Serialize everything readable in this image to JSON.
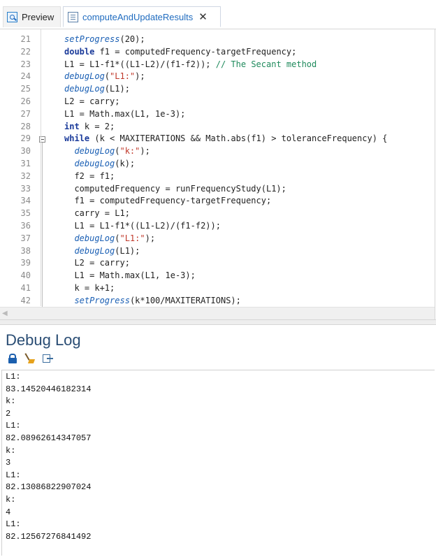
{
  "tabs": {
    "preview_label": "Preview",
    "active_label": "computeAndUpdateResults"
  },
  "code": {
    "lines": [
      {
        "n": "21",
        "segs": [
          {
            "t": "setProgress",
            "c": "fn"
          },
          {
            "t": "(20);",
            "c": ""
          }
        ]
      },
      {
        "n": "22",
        "segs": [
          {
            "t": "double",
            "c": "kw"
          },
          {
            "t": " f1 = computedFrequency-targetFrequency;",
            "c": ""
          }
        ]
      },
      {
        "n": "23",
        "segs": [
          {
            "t": "L1 = L1-f1*((L1-L2)/(f1-f2)); ",
            "c": ""
          },
          {
            "t": "// The Secant method",
            "c": "cmt"
          }
        ]
      },
      {
        "n": "24",
        "segs": [
          {
            "t": "debugLog",
            "c": "fn"
          },
          {
            "t": "(",
            "c": ""
          },
          {
            "t": "\"L1:\"",
            "c": "str"
          },
          {
            "t": ");",
            "c": ""
          }
        ]
      },
      {
        "n": "25",
        "segs": [
          {
            "t": "debugLog",
            "c": "fn"
          },
          {
            "t": "(L1);",
            "c": ""
          }
        ]
      },
      {
        "n": "26",
        "segs": [
          {
            "t": "L2 = carry;",
            "c": ""
          }
        ]
      },
      {
        "n": "27",
        "segs": [
          {
            "t": "L1 = Math.max(L1, 1e-3);",
            "c": ""
          }
        ]
      },
      {
        "n": "28",
        "segs": [
          {
            "t": "int",
            "c": "kw"
          },
          {
            "t": " k = 2;",
            "c": ""
          }
        ]
      },
      {
        "n": "29",
        "segs": [
          {
            "t": "while",
            "c": "kw"
          },
          {
            "t": " (k < MAXITERATIONS && Math.abs(f1) > toleranceFrequency) {",
            "c": ""
          }
        ]
      },
      {
        "n": "30",
        "segs": [
          {
            "t": "  ",
            "c": ""
          },
          {
            "t": "debugLog",
            "c": "fn"
          },
          {
            "t": "(",
            "c": ""
          },
          {
            "t": "\"k:\"",
            "c": "str"
          },
          {
            "t": ");",
            "c": ""
          }
        ]
      },
      {
        "n": "31",
        "segs": [
          {
            "t": "  ",
            "c": ""
          },
          {
            "t": "debugLog",
            "c": "fn"
          },
          {
            "t": "(k);",
            "c": ""
          }
        ]
      },
      {
        "n": "32",
        "segs": [
          {
            "t": "  f2 = f1;",
            "c": ""
          }
        ]
      },
      {
        "n": "33",
        "segs": [
          {
            "t": "  computedFrequency = runFrequencyStudy(L1);",
            "c": ""
          }
        ]
      },
      {
        "n": "34",
        "segs": [
          {
            "t": "  f1 = computedFrequency-targetFrequency;",
            "c": ""
          }
        ]
      },
      {
        "n": "35",
        "segs": [
          {
            "t": "  carry = L1;",
            "c": ""
          }
        ]
      },
      {
        "n": "36",
        "segs": [
          {
            "t": "  L1 = L1-f1*((L1-L2)/(f1-f2));",
            "c": ""
          }
        ]
      },
      {
        "n": "37",
        "segs": [
          {
            "t": "  ",
            "c": ""
          },
          {
            "t": "debugLog",
            "c": "fn"
          },
          {
            "t": "(",
            "c": ""
          },
          {
            "t": "\"L1:\"",
            "c": "str"
          },
          {
            "t": ");",
            "c": ""
          }
        ]
      },
      {
        "n": "38",
        "segs": [
          {
            "t": "  ",
            "c": ""
          },
          {
            "t": "debugLog",
            "c": "fn"
          },
          {
            "t": "(L1);",
            "c": ""
          }
        ]
      },
      {
        "n": "39",
        "segs": [
          {
            "t": "  L2 = carry;",
            "c": ""
          }
        ]
      },
      {
        "n": "40",
        "segs": [
          {
            "t": "  L1 = Math.max(L1, 1e-3);",
            "c": ""
          }
        ]
      },
      {
        "n": "41",
        "segs": [
          {
            "t": "  k = k+1;",
            "c": ""
          }
        ]
      },
      {
        "n": "42",
        "segs": [
          {
            "t": "  ",
            "c": ""
          },
          {
            "t": "setProgress",
            "c": "fn"
          },
          {
            "t": "(k*100/MAXITERATIONS);",
            "c": ""
          }
        ]
      }
    ],
    "fold_line": "29"
  },
  "debug_log": {
    "title": "Debug Log",
    "toolbar_icons": [
      "lock-icon",
      "broom-icon",
      "export-icon"
    ],
    "output_lines": [
      "L1:",
      "83.14520446182314",
      "k:",
      "2",
      "L1:",
      "82.08962614347057",
      "k:",
      "3",
      "L1:",
      "82.13086822907024",
      "k:",
      "4",
      "L1:",
      "82.12567276841492"
    ]
  },
  "colors": {
    "keyword": "#1a3a9a",
    "function": "#1a5fb4",
    "string": "#c0392b",
    "comment": "#1f8a5c",
    "tab_active": "#1f6bbf",
    "debug_title": "#2a4d74"
  }
}
